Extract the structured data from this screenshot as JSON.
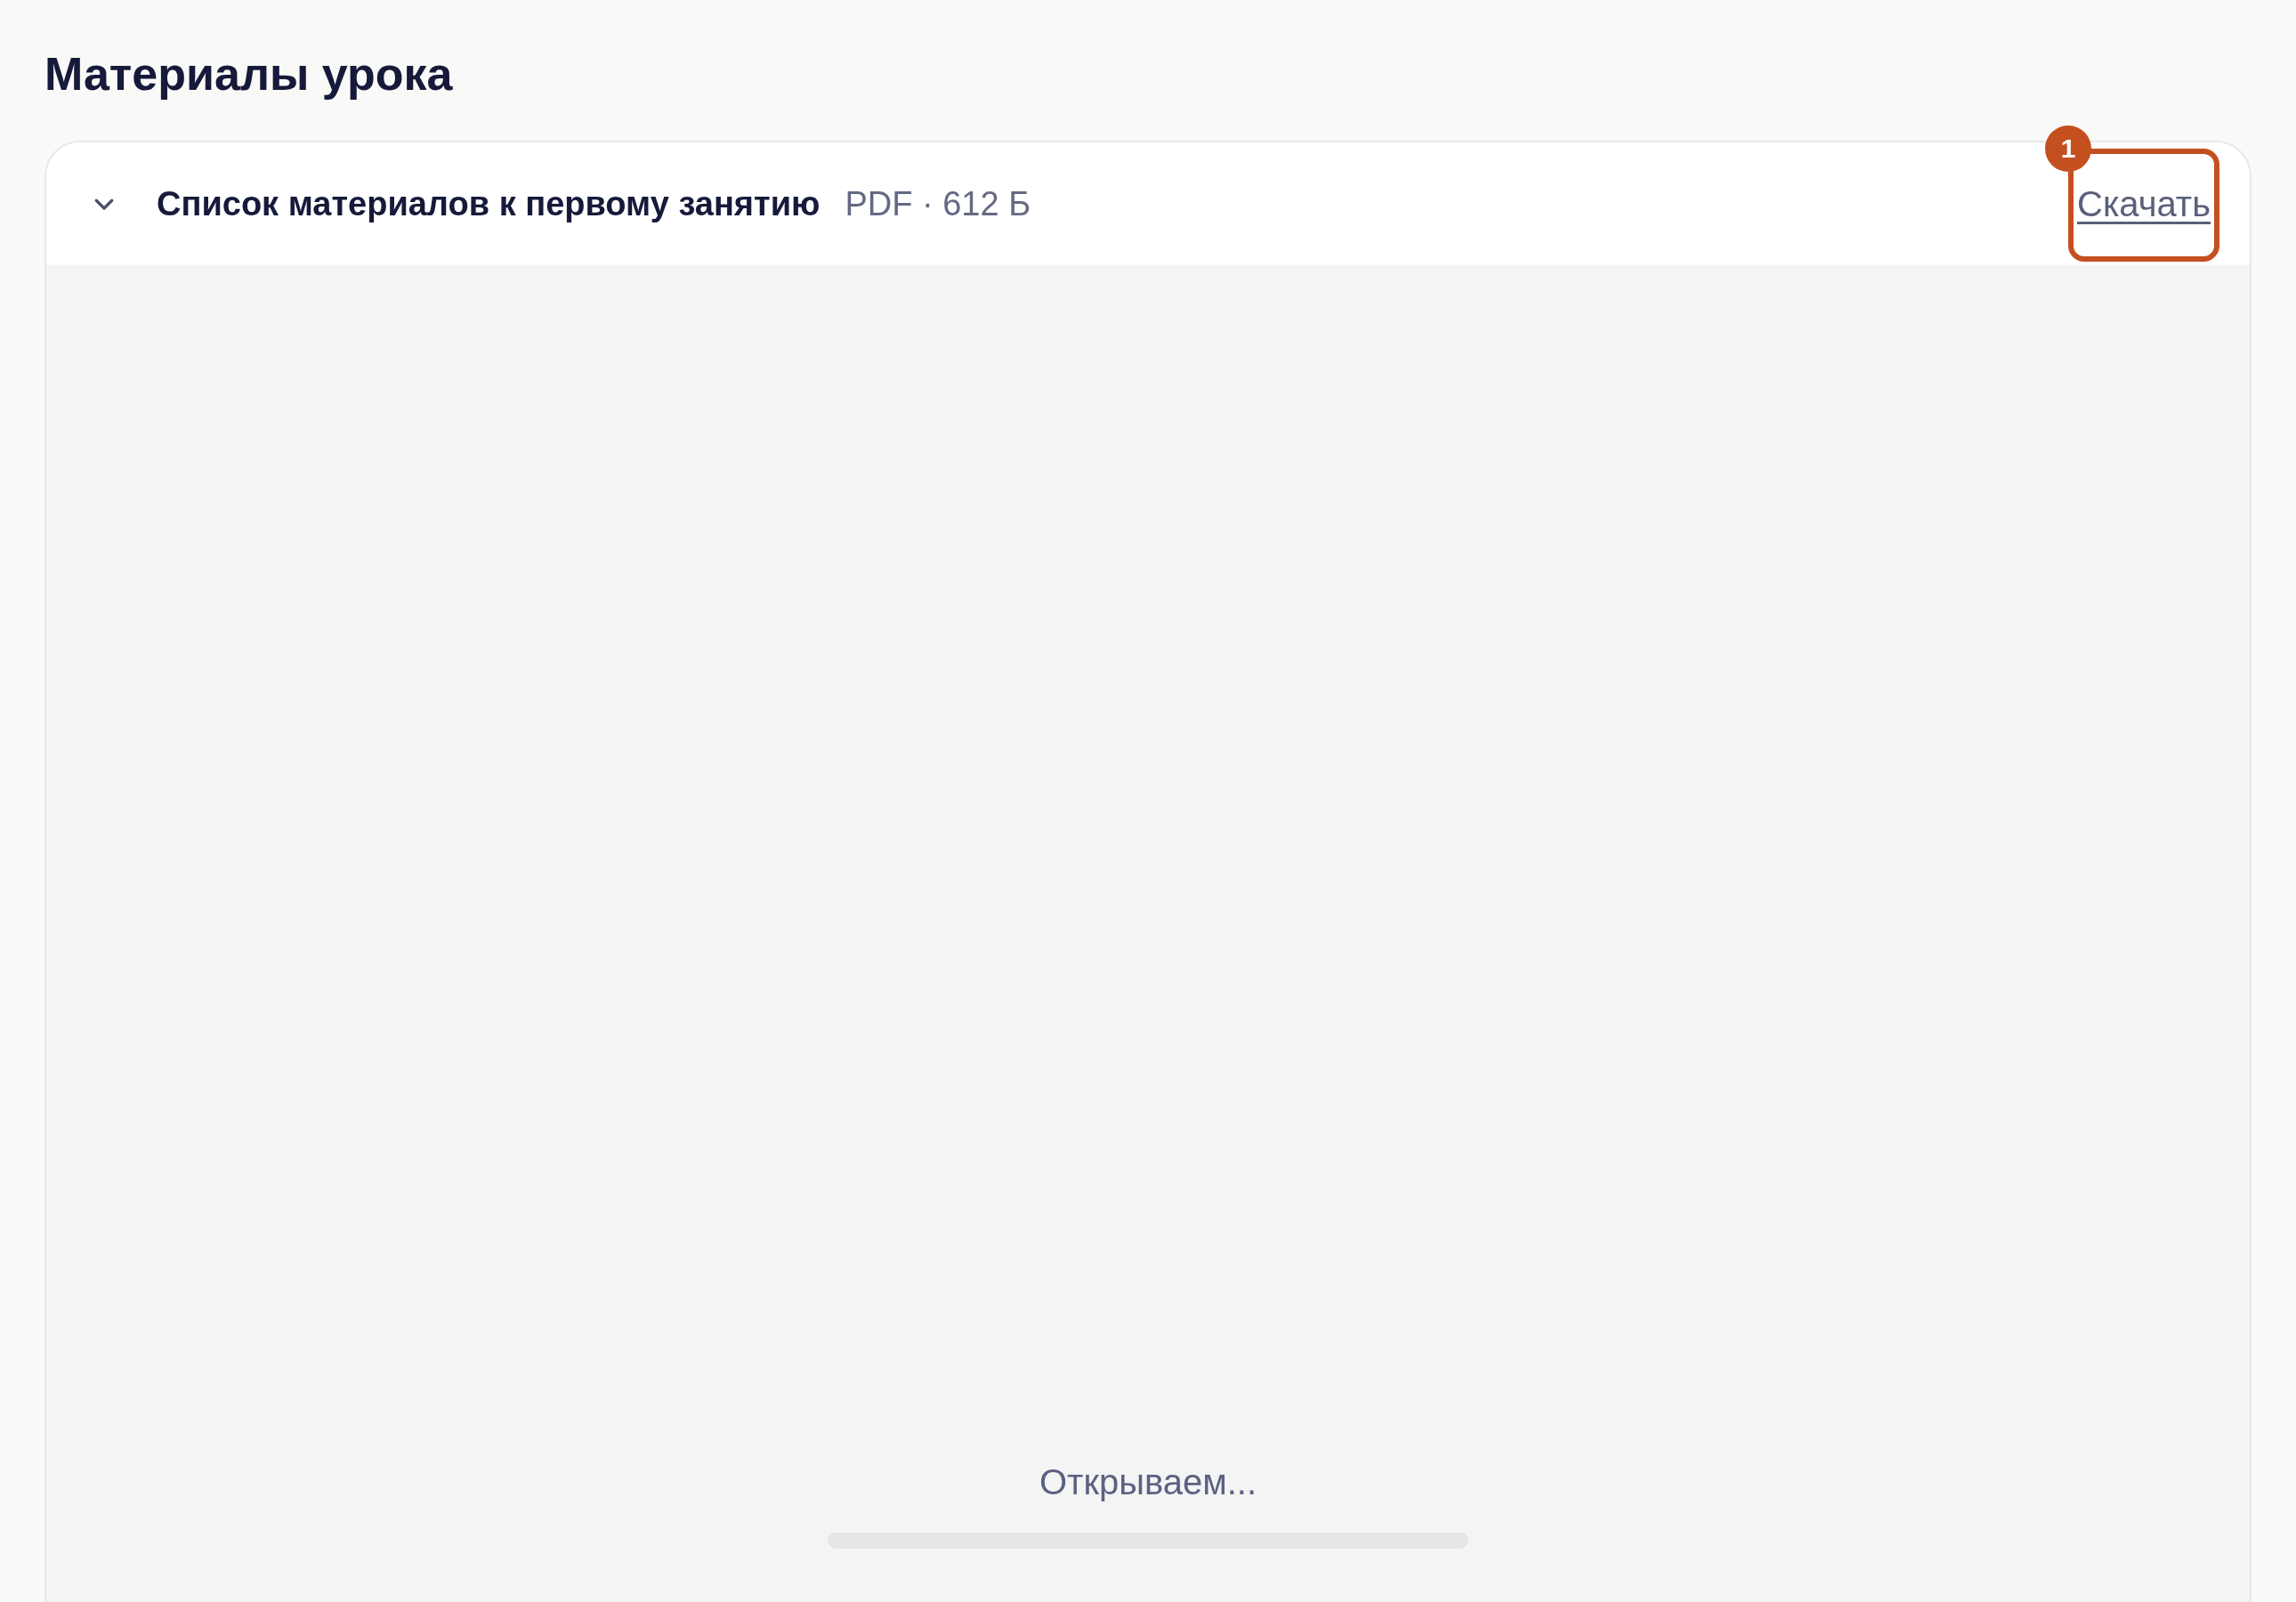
{
  "page": {
    "title": "Материалы урока"
  },
  "attachment": {
    "expanded": true,
    "name": "Список материалов к первому занятию",
    "meta": "PDF · 612 Б",
    "download_link": "Скачать",
    "preview": {
      "status": "Открываем...",
      "level": 0
    }
  },
  "annotation": {
    "number": "1"
  }
}
